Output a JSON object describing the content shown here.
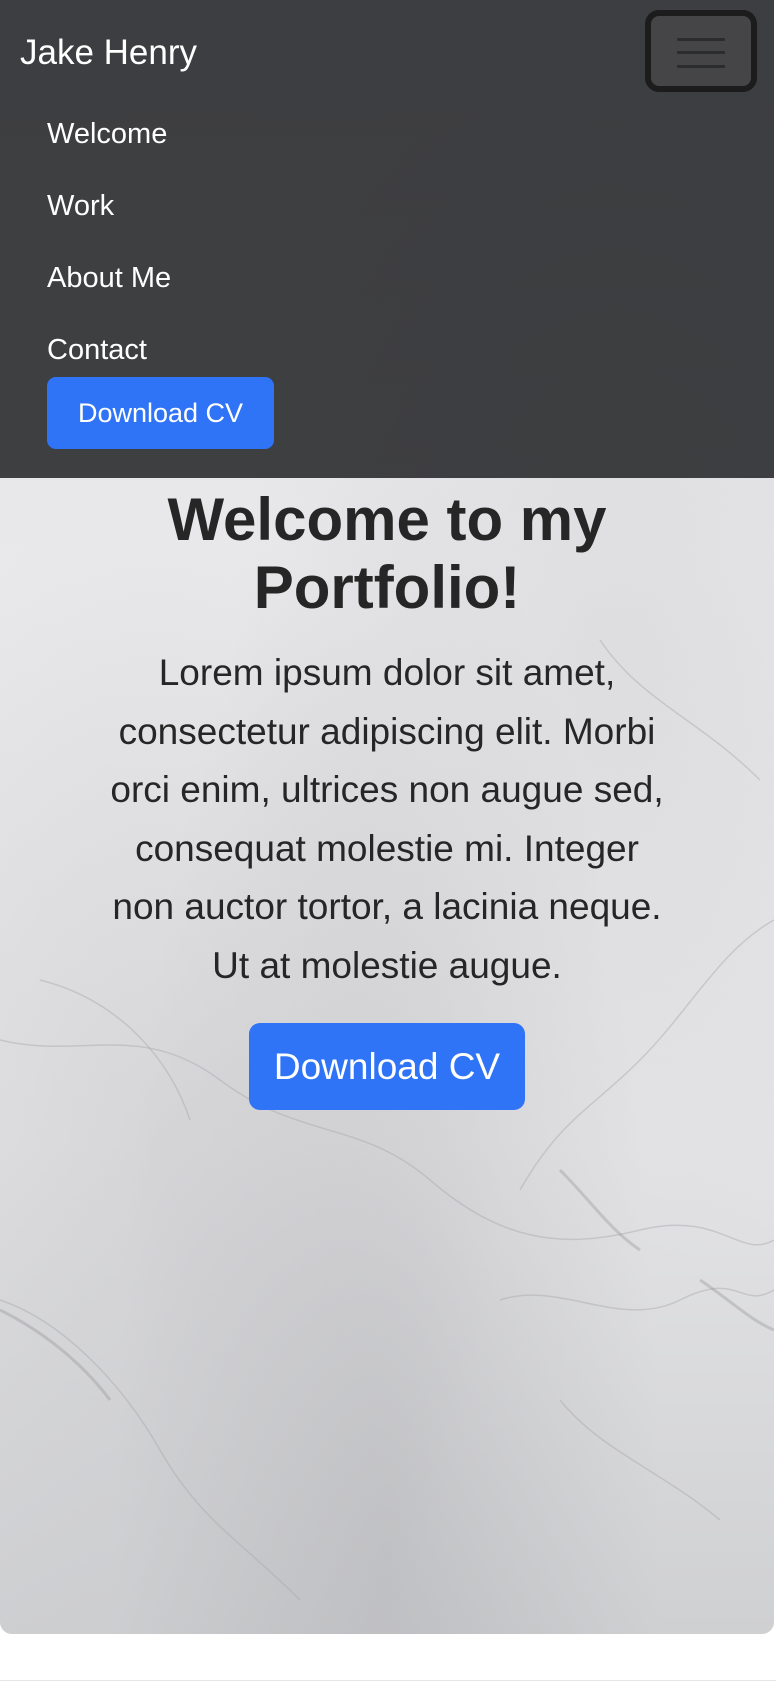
{
  "navbar": {
    "brand": "Jake Henry",
    "toggler_icon": "hamburger-menu-icon",
    "links": [
      {
        "label": "Welcome"
      },
      {
        "label": "Work"
      },
      {
        "label": "About Me"
      },
      {
        "label": "Contact"
      }
    ],
    "cta_label": "Download CV",
    "background_color": "#38393b"
  },
  "hero": {
    "title": "Welcome to my Portfolio!",
    "text": "Lorem ipsum dolor sit amet, consectetur adipiscing elit. Morbi orci enim, ultrices non augue sed, consequat molestie mi. Integer non auctor tortor, a lacinia neque. Ut at molestie augue.",
    "cta_label": "Download CV",
    "background": "marble"
  },
  "colors": {
    "accent": "#2f74f6",
    "text": "#262626"
  }
}
